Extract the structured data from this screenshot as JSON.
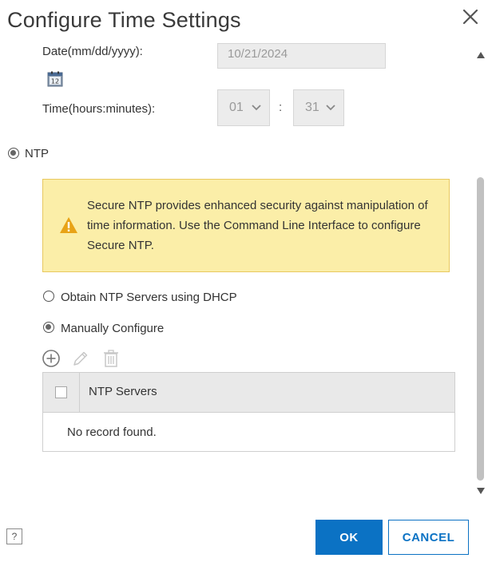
{
  "dialog": {
    "title": "Configure Time Settings"
  },
  "date": {
    "label": "Date(mm/dd/yyyy):",
    "value": "10/21/2024",
    "calendar_icon_text": "12"
  },
  "time": {
    "label": "Time(hours:minutes):",
    "hours": "01",
    "minutes": "31",
    "separator": ":"
  },
  "ntp": {
    "radio_label": "NTP",
    "selected": true,
    "warning": {
      "text": "Secure NTP provides enhanced security against manipulation of time information. Use the Command Line Interface to configure Secure NTP."
    },
    "options": [
      {
        "label": "Obtain NTP Servers using DHCP",
        "selected": false
      },
      {
        "label": "Manually Configure",
        "selected": true
      }
    ],
    "table": {
      "header": "NTP Servers",
      "empty_message": "No record found."
    }
  },
  "footer": {
    "help_label": "?",
    "ok_label": "OK",
    "cancel_label": "CANCEL"
  },
  "colors": {
    "primary": "#0b72c4",
    "warning_bg": "#fbeea8",
    "warning_icon": "#e8a317"
  }
}
